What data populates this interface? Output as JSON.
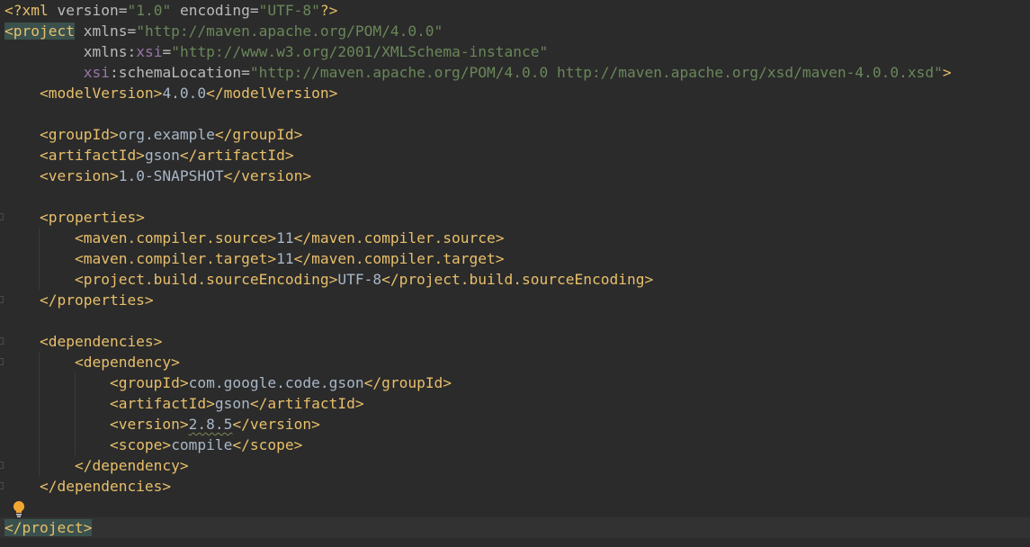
{
  "editor": {
    "file_type": "xml",
    "colors": {
      "background": "#2b2b2b",
      "tag": "#e8bf6a",
      "text": "#a9b7c6",
      "attr_value": "#6a8759",
      "namespace": "#9876aa",
      "match_highlight": "#3b514d"
    },
    "lines": [
      {
        "prolog_open": "<?xml ",
        "a1": "version",
        "eq1": "=",
        "v1": "\"1.0\"",
        "sp": " ",
        "a2": "encoding",
        "eq2": "=",
        "v2": "\"UTF-8\"",
        "prolog_close": "?>"
      },
      {
        "open": "<project",
        "sp": " ",
        "attr": "xmlns",
        "eq": "=",
        "val": "\"http://maven.apache.org/POM/4.0.0\""
      },
      {
        "indent": "         ",
        "attr1": "xmlns:",
        "ns": "xsi",
        "eq": "=",
        "val": "\"http://www.w3.org/2001/XMLSchema-instance\""
      },
      {
        "indent": "         ",
        "ns": "xsi",
        "attr": ":schemaLocation",
        "eq": "=",
        "val": "\"http://maven.apache.org/POM/4.0.0 http://maven.apache.org/xsd/maven-4.0.0.xsd\"",
        "close": ">"
      },
      {
        "indent": "    ",
        "open": "<modelVersion>",
        "text": "4.0.0",
        "close": "</modelVersion>"
      },
      {
        "text": ""
      },
      {
        "indent": "    ",
        "open": "<groupId>",
        "text": "org.example",
        "close": "</groupId>"
      },
      {
        "indent": "    ",
        "open": "<artifactId>",
        "text": "gson",
        "close": "</artifactId>"
      },
      {
        "indent": "    ",
        "open": "<version>",
        "text": "1.0-SNAPSHOT",
        "close": "</version>"
      },
      {
        "text": ""
      },
      {
        "indent": "    ",
        "open": "<properties>"
      },
      {
        "indent": "        ",
        "open": "<maven.compiler.source>",
        "text": "11",
        "close": "</maven.compiler.source>"
      },
      {
        "indent": "        ",
        "open": "<maven.compiler.target>",
        "text": "11",
        "close": "</maven.compiler.target>"
      },
      {
        "indent": "        ",
        "open": "<project.build.sourceEncoding>",
        "text": "UTF-8",
        "close": "</project.build.sourceEncoding>"
      },
      {
        "indent": "    ",
        "close": "</properties>"
      },
      {
        "text": ""
      },
      {
        "indent": "    ",
        "open": "<dependencies>"
      },
      {
        "indent": "        ",
        "open": "<dependency>"
      },
      {
        "indent": "            ",
        "open": "<groupId>",
        "text": "com.google.code.gson",
        "close": "</groupId>"
      },
      {
        "indent": "            ",
        "open": "<artifactId>",
        "text": "gson",
        "close": "</artifactId>"
      },
      {
        "indent": "            ",
        "open": "<version>",
        "text": "2.8.5",
        "close": "</version>"
      },
      {
        "indent": "            ",
        "open": "<scope>",
        "text": "compile",
        "close": "</scope>"
      },
      {
        "indent": "        ",
        "close": "</dependency>"
      },
      {
        "indent": "    ",
        "close": "</dependencies>"
      },
      {
        "text": ""
      },
      {
        "close": "</project>"
      }
    ],
    "gutter": {
      "intention_icon": "lightbulb-icon"
    }
  }
}
